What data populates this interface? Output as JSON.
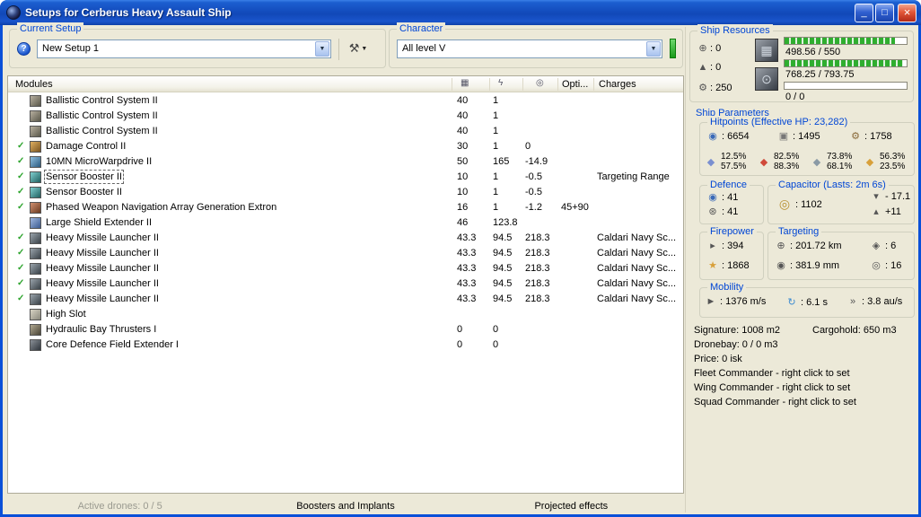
{
  "icons": {
    "check": "✓",
    "help": "?",
    "wrench": "⚒",
    "dropdown_arrow": "▼",
    "minimize": "_",
    "maximize": "□",
    "close": "×",
    "cpu_col": "▦",
    "pg_col": "ϟ",
    "cap_col": "◎",
    "turret": "⊕",
    "launcher": "▲",
    "calibration": "⚙",
    "chip": "▦",
    "reactor": "⊙",
    "shield": "◉",
    "armor": "▣",
    "structure": "⚙",
    "em": "◆",
    "thermal": "◆",
    "kinetic": "◆",
    "explosive": "◆",
    "defence1": "◉",
    "defence2": "⊛",
    "capacitor": "◎",
    "cap_minus": "▾",
    "cap_plus": "▴",
    "dps": "▸",
    "volley": "★",
    "range": "⊕",
    "max_targets": "◈",
    "scan_res": "◉",
    "sensor": "◎",
    "speed": "►",
    "align": "↻",
    "warp": "»"
  },
  "window": {
    "title": "Setups for Cerberus Heavy Assault Ship"
  },
  "current_setup": {
    "label": "Current Setup",
    "value": "New Setup 1"
  },
  "character": {
    "label": "Character",
    "value": "All level V"
  },
  "modules": {
    "header": {
      "name": "Modules",
      "opti": "Opti...",
      "charges": "Charges"
    },
    "rows": [
      {
        "name": "Ballistic Control System II",
        "icon": "ballistic-control",
        "active": false,
        "selected": false,
        "c1": "40",
        "c2": "1",
        "c3": "",
        "opti": "",
        "charges": ""
      },
      {
        "name": "Ballistic Control System II",
        "icon": "ballistic-control",
        "active": false,
        "selected": false,
        "c1": "40",
        "c2": "1",
        "c3": "",
        "opti": "",
        "charges": ""
      },
      {
        "name": "Ballistic Control System II",
        "icon": "ballistic-control",
        "active": false,
        "selected": false,
        "c1": "40",
        "c2": "1",
        "c3": "",
        "opti": "",
        "charges": ""
      },
      {
        "name": "Damage Control II",
        "icon": "damage-control",
        "active": true,
        "selected": false,
        "c1": "30",
        "c2": "1",
        "c3": "0",
        "opti": "",
        "charges": ""
      },
      {
        "name": "10MN MicroWarpdrive II",
        "icon": "microwarpdrive",
        "active": true,
        "selected": false,
        "c1": "50",
        "c2": "165",
        "c3": "-14.9",
        "opti": "",
        "charges": ""
      },
      {
        "name": "Sensor Booster II",
        "icon": "sensor-booster",
        "active": true,
        "selected": true,
        "c1": "10",
        "c2": "1",
        "c3": "-0.5",
        "opti": "",
        "charges": "Targeting Range"
      },
      {
        "name": "Sensor Booster II",
        "icon": "sensor-booster",
        "active": true,
        "selected": false,
        "c1": "10",
        "c2": "1",
        "c3": "-0.5",
        "opti": "",
        "charges": ""
      },
      {
        "name": "Phased Weapon Navigation Array Generation Extron",
        "icon": "target-painter",
        "active": true,
        "selected": false,
        "c1": "16",
        "c2": "1",
        "c3": "-1.2",
        "opti": "45+90",
        "charges": ""
      },
      {
        "name": "Large Shield Extender II",
        "icon": "shield-extender",
        "active": false,
        "selected": false,
        "c1": "46",
        "c2": "123.8",
        "c3": "",
        "opti": "",
        "charges": ""
      },
      {
        "name": "Heavy Missile Launcher II",
        "icon": "missile-launcher",
        "active": true,
        "selected": false,
        "c1": "43.3",
        "c2": "94.5",
        "c3": "218.3",
        "opti": "",
        "charges": "Caldari Navy Sc..."
      },
      {
        "name": "Heavy Missile Launcher II",
        "icon": "missile-launcher",
        "active": true,
        "selected": false,
        "c1": "43.3",
        "c2": "94.5",
        "c3": "218.3",
        "opti": "",
        "charges": "Caldari Navy Sc..."
      },
      {
        "name": "Heavy Missile Launcher II",
        "icon": "missile-launcher",
        "active": true,
        "selected": false,
        "c1": "43.3",
        "c2": "94.5",
        "c3": "218.3",
        "opti": "",
        "charges": "Caldari Navy Sc..."
      },
      {
        "name": "Heavy Missile Launcher II",
        "icon": "missile-launcher",
        "active": true,
        "selected": false,
        "c1": "43.3",
        "c2": "94.5",
        "c3": "218.3",
        "opti": "",
        "charges": "Caldari Navy Sc..."
      },
      {
        "name": "Heavy Missile Launcher II",
        "icon": "missile-launcher",
        "active": true,
        "selected": false,
        "c1": "43.3",
        "c2": "94.5",
        "c3": "218.3",
        "opti": "",
        "charges": "Caldari Navy Sc..."
      },
      {
        "name": "High Slot",
        "icon": "high-slot",
        "active": false,
        "selected": false,
        "c1": "",
        "c2": "",
        "c3": "",
        "opti": "",
        "charges": ""
      },
      {
        "name": "Hydraulic Bay Thrusters I",
        "icon": "bay-thruster",
        "active": false,
        "selected": false,
        "c1": "0",
        "c2": "0",
        "c3": "",
        "opti": "",
        "charges": ""
      },
      {
        "name": "Core Defence Field Extender I",
        "icon": "core-rig",
        "active": false,
        "selected": false,
        "c1": "0",
        "c2": "0",
        "c3": "",
        "opti": "",
        "charges": ""
      }
    ]
  },
  "bottom_tabs": [
    {
      "label": "Active drones: 0 / 5"
    },
    {
      "label": "Boosters and Implants"
    },
    {
      "label": "Projected effects"
    }
  ],
  "ship_resources": {
    "label": "Ship Resources",
    "turrets": ": 0",
    "launchers": ": 0",
    "calibration": ": 250",
    "cpu": {
      "text": "498.56 / 550",
      "pct": 90.6
    },
    "powergrid": {
      "text": "768.25 / 793.75",
      "pct": 96.8
    },
    "drones": {
      "text": "0 / 0",
      "pct": 0
    }
  },
  "ship_parameters": {
    "label": "Ship Parameters",
    "hitpoints": {
      "label": "Hitpoints (Effective HP: 23,282)",
      "shield": ": 6654",
      "armor": ": 1495",
      "structure": ": 1758",
      "resists": [
        {
          "top": "12.5%",
          "bottom": "57.5%"
        },
        {
          "top": "82.5%",
          "bottom": "88.3%"
        },
        {
          "top": "73.8%",
          "bottom": "68.1%"
        },
        {
          "top": "56.3%",
          "bottom": "23.5%"
        }
      ]
    },
    "defence": {
      "label": "Defence",
      "v1": ": 41",
      "v2": ": 41"
    },
    "capacitor": {
      "label": "Capacitor (Lasts: 2m 6s)",
      "amount": ": 1102",
      "drain": "- 17.1",
      "recharge": "+11"
    },
    "firepower": {
      "label": "Firepower",
      "dps": ": 394",
      "volley": ": 1868"
    },
    "targeting": {
      "label": "Targeting",
      "range": ": 201.72 km",
      "max_targets": ": 6",
      "scan_res": ": 381.9 mm",
      "sensor": ": 16"
    },
    "mobility": {
      "label": "Mobility",
      "speed": ": 1376 m/s",
      "align": ": 6.1 s",
      "warp": ": 3.8 au/s"
    }
  },
  "info": {
    "signature": "Signature: 1008 m2",
    "cargohold": "Cargohold: 650 m3",
    "dronebay": "Dronebay: 0 / 0 m3",
    "price": "Price: 0 isk",
    "fleet": "Fleet Commander - right click to set",
    "wing": "Wing Commander - right click to set",
    "squad": "Squad Commander - right click to set"
  }
}
